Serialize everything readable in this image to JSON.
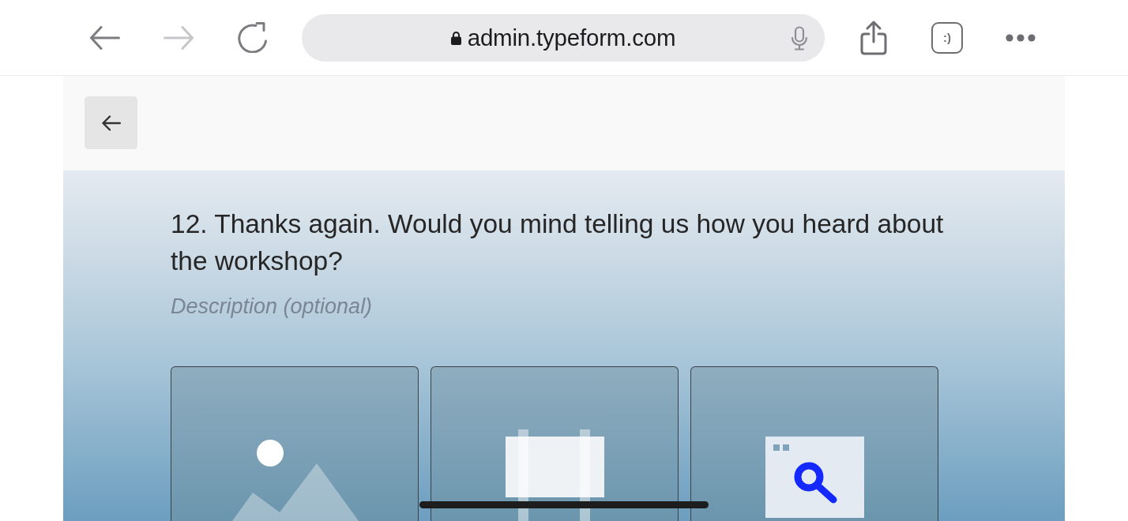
{
  "browser": {
    "nav_buttons": [
      {
        "kind": "back",
        "disabled": false
      },
      {
        "kind": "forward",
        "disabled": true
      },
      {
        "kind": "reload",
        "disabled": false
      }
    ],
    "url": "admin.typeform.com",
    "secure": true,
    "tabs_label": ":)"
  },
  "question": {
    "text": "12. Thanks again. Would you mind telling us how you heard about the workshop?",
    "description": {
      "placeholder": "Description (optional)"
    }
  },
  "choices": [
    {
      "kind": "image",
      "selected": false
    },
    {
      "kind": "billboard",
      "selected": false
    },
    {
      "kind": "search",
      "selected": false
    }
  ]
}
